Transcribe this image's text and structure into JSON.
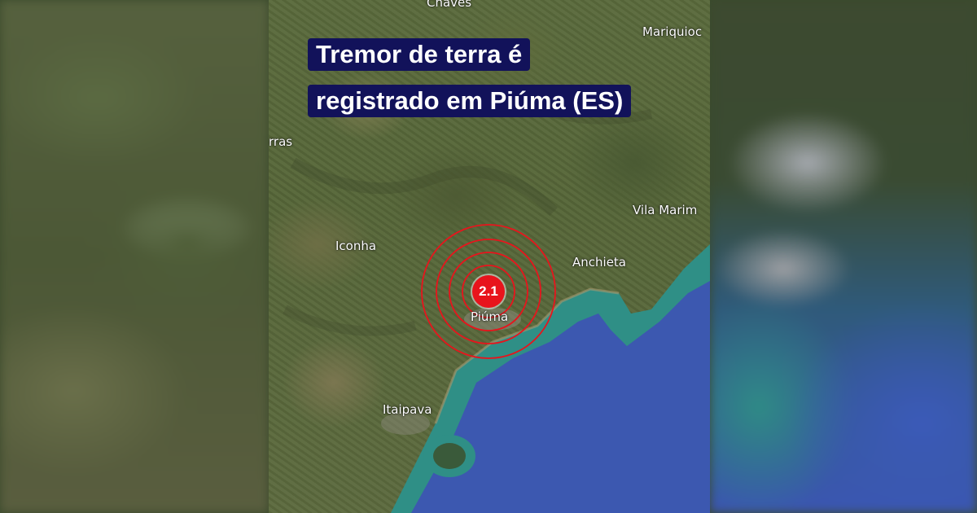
{
  "title": {
    "line1": "Tremor de terra é",
    "line2": "registrado em Piúma (ES)"
  },
  "magnitude": "2.1",
  "places": {
    "chaves": "Chaves",
    "mariquioca": "Mariquioc",
    "terras": "rras",
    "iconha": "Iconha",
    "vila_marim": "Vila Marim",
    "anchieta": "Anchieta",
    "piuma": "Piúma",
    "itaipava": "Itaipava"
  },
  "colors": {
    "title_bg": "#12125a",
    "ring": "#e8141c",
    "ocean": "#3c58b0",
    "shallow": "#2f8f86"
  }
}
